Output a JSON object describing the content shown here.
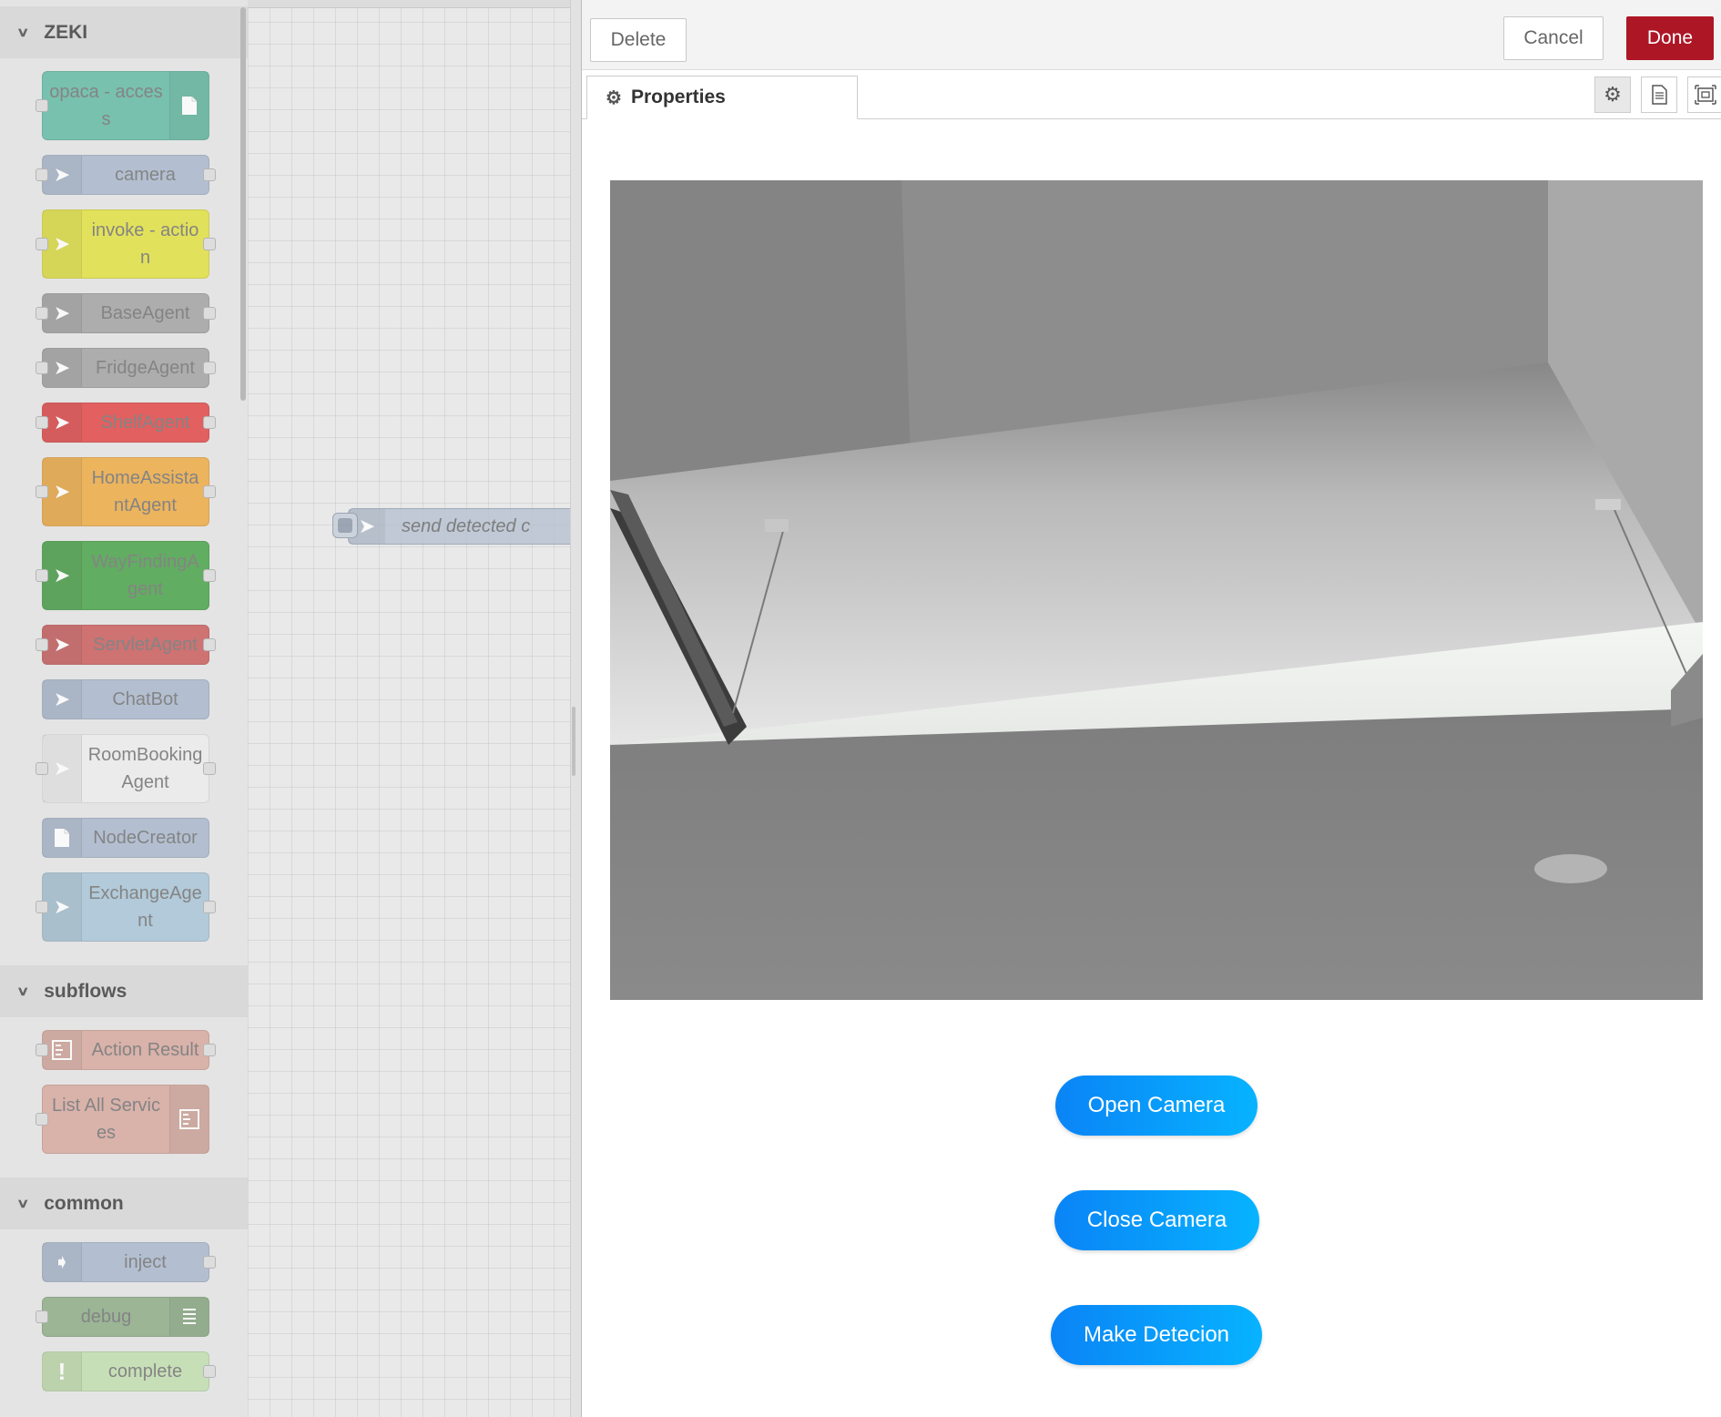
{
  "palette": {
    "sections": [
      {
        "title": "ZEKI",
        "nodes": [
          {
            "label": "opaca - access",
            "color": "#5bb8a0",
            "icon": "file-icon",
            "icon_side": "right",
            "in": true,
            "out": false,
            "lines": 2
          },
          {
            "label": "camera",
            "color": "#a6b5cc",
            "icon": "arrow-icon",
            "icon_side": "left",
            "in": true,
            "out": true,
            "lines": 1
          },
          {
            "label": "invoke - action",
            "color": "#e2e135",
            "icon": "arrow-icon",
            "icon_side": "left",
            "in": true,
            "out": true,
            "lines": 2
          },
          {
            "label": "BaseAgent",
            "color": "#9e9e9e",
            "icon": "arrow-icon",
            "icon_side": "left",
            "in": true,
            "out": true,
            "lines": 1
          },
          {
            "label": "FridgeAgent",
            "color": "#9e9e9e",
            "icon": "arrow-icon",
            "icon_side": "left",
            "in": true,
            "out": true,
            "lines": 1
          },
          {
            "label": "ShelfAgent",
            "color": "#e23c3c",
            "icon": "arrow-icon",
            "icon_side": "left",
            "in": true,
            "out": true,
            "lines": 1
          },
          {
            "label": "HomeAssistantAgent",
            "color": "#efa738",
            "icon": "arrow-icon",
            "icon_side": "left",
            "in": true,
            "out": true,
            "lines": 2
          },
          {
            "label": "WayFindingAgent",
            "color": "#3d9e3d",
            "icon": "arrow-icon",
            "icon_side": "left",
            "in": true,
            "out": true,
            "lines": 2
          },
          {
            "label": "ServletAgent",
            "color": "#c95353",
            "icon": "arrow-icon",
            "icon_side": "left",
            "in": true,
            "out": true,
            "lines": 1
          },
          {
            "label": "ChatBot",
            "color": "#a6b5cc",
            "icon": "arrow-icon",
            "icon_side": "left",
            "in": false,
            "out": false,
            "lines": 1
          },
          {
            "label": "RoomBookingAgent",
            "color": "#eeeeee",
            "icon": "arrow-icon",
            "icon_side": "left",
            "in": true,
            "out": true,
            "lines": 2
          },
          {
            "label": "NodeCreator",
            "color": "#a6b5cc",
            "icon": "file-icon",
            "icon_side": "left",
            "in": false,
            "out": false,
            "lines": 1
          },
          {
            "label": "ExchangeAgent",
            "color": "#a5c3d6",
            "icon": "arrow-icon",
            "icon_side": "left",
            "in": true,
            "out": true,
            "lines": 2
          }
        ]
      },
      {
        "title": "subflows",
        "nodes": [
          {
            "label": "Action Result",
            "color": "#d6a59a",
            "icon": "subflow-icon",
            "icon_side": "left",
            "in": true,
            "out": true,
            "lines": 1
          },
          {
            "label": "List All Services",
            "color": "#d6a59a",
            "icon": "subflow-icon",
            "icon_side": "right",
            "in": true,
            "out": false,
            "lines": 2
          }
        ]
      },
      {
        "title": "common",
        "nodes": [
          {
            "label": "inject",
            "color": "#a6b5cc",
            "icon": "inject-icon",
            "icon_side": "left",
            "in": false,
            "out": true,
            "lines": 1
          },
          {
            "label": "debug",
            "color": "#87a980",
            "icon": "list-icon",
            "icon_side": "right",
            "in": true,
            "out": false,
            "lines": 1
          },
          {
            "label": "complete",
            "color": "#c0deab",
            "icon": "exclamation-icon",
            "icon_side": "left",
            "in": false,
            "out": true,
            "lines": 1
          }
        ]
      }
    ]
  },
  "workspace": {
    "flow_node_label": "send detected c"
  },
  "tray": {
    "delete_label": "Delete",
    "cancel_label": "Cancel",
    "done_label": "Done",
    "done_color": "#ad1625",
    "tab_label": "Properties"
  },
  "actions": {
    "open_camera": "Open Camera",
    "close_camera": "Close Camera",
    "make_detection": "Make Detecion"
  }
}
